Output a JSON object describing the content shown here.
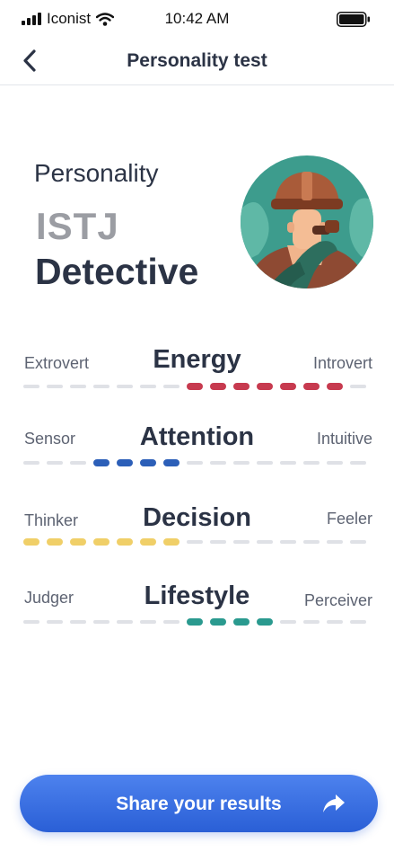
{
  "status_bar": {
    "carrier": "Iconist",
    "time": "10:42 AM"
  },
  "nav": {
    "title": "Personality test",
    "back_icon": "chevron-left-icon"
  },
  "personality": {
    "label": "Personality",
    "code": "ISTJ",
    "name": "Detective",
    "avatar_icon": "detective-avatar-icon"
  },
  "traits": [
    {
      "left": "Extrovert",
      "title": "Energy",
      "right": "Introvert",
      "color": "#c73a4f",
      "filled_start": 7,
      "filled_count": 7
    },
    {
      "left": "Sensor",
      "title": "Attention",
      "right": "Intuitive",
      "color": "#2c5fb8",
      "filled_start": 3,
      "filled_count": 4
    },
    {
      "left": "Thinker",
      "title": "Decision",
      "right": "Feeler",
      "color": "#f0cf68",
      "filled_start": 0,
      "filled_count": 7
    },
    {
      "left": "Judger",
      "title": "Lifestyle",
      "right": "Perceiver",
      "color": "#2a9a8f",
      "filled_start": 7,
      "filled_count": 4
    }
  ],
  "share": {
    "label": "Share your results",
    "icon": "share-arrow-icon"
  },
  "colors": {
    "text_dark": "#2b3345",
    "text_muted": "#5d6372",
    "inactive_dash": "#dfe1e6",
    "accent": "#3a6fe0"
  }
}
